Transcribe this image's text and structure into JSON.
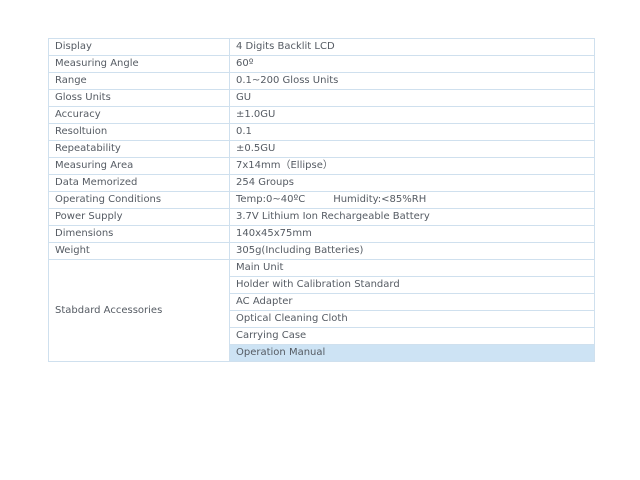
{
  "specs": [
    {
      "label": "Display",
      "value": "4 Digits Backlit LCD"
    },
    {
      "label": "Measuring Angle",
      "value": "60º"
    },
    {
      "label": "Range",
      "value": "0.1~200 Gloss Units"
    },
    {
      "label": "Gloss Units",
      "value": "GU"
    },
    {
      "label": "Accuracy",
      "value": "±1.0GU"
    },
    {
      "label": "Resoltuion",
      "value": "0.1"
    },
    {
      "label": "Repeatability",
      "value": "±0.5GU"
    },
    {
      "label": "Measuring Area",
      "value": "7x14mm（Ellipse）"
    },
    {
      "label": "Data Memorized",
      "value": "254 Groups"
    },
    {
      "label": "Operating Conditions",
      "value": "Temp:0~40ºC",
      "value2": "Humidity:<85%RH"
    },
    {
      "label": "Power Supply",
      "value": "3.7V Lithium Ion Rechargeable Battery"
    },
    {
      "label": "Dimensions",
      "value": "140x45x75mm"
    },
    {
      "label": "Weight",
      "value": "305g(Including Batteries)"
    }
  ],
  "accessories": {
    "label": "Stabdard Accessories",
    "items": [
      "Main Unit",
      "Holder with Calibration Standard",
      "AC Adapter",
      "Optical Cleaning Cloth",
      "Carrying Case",
      "Operation Manual"
    ]
  },
  "colors": {
    "border": "#cfe0ee",
    "highlight": "#cde3f4",
    "text": "#555b63"
  }
}
